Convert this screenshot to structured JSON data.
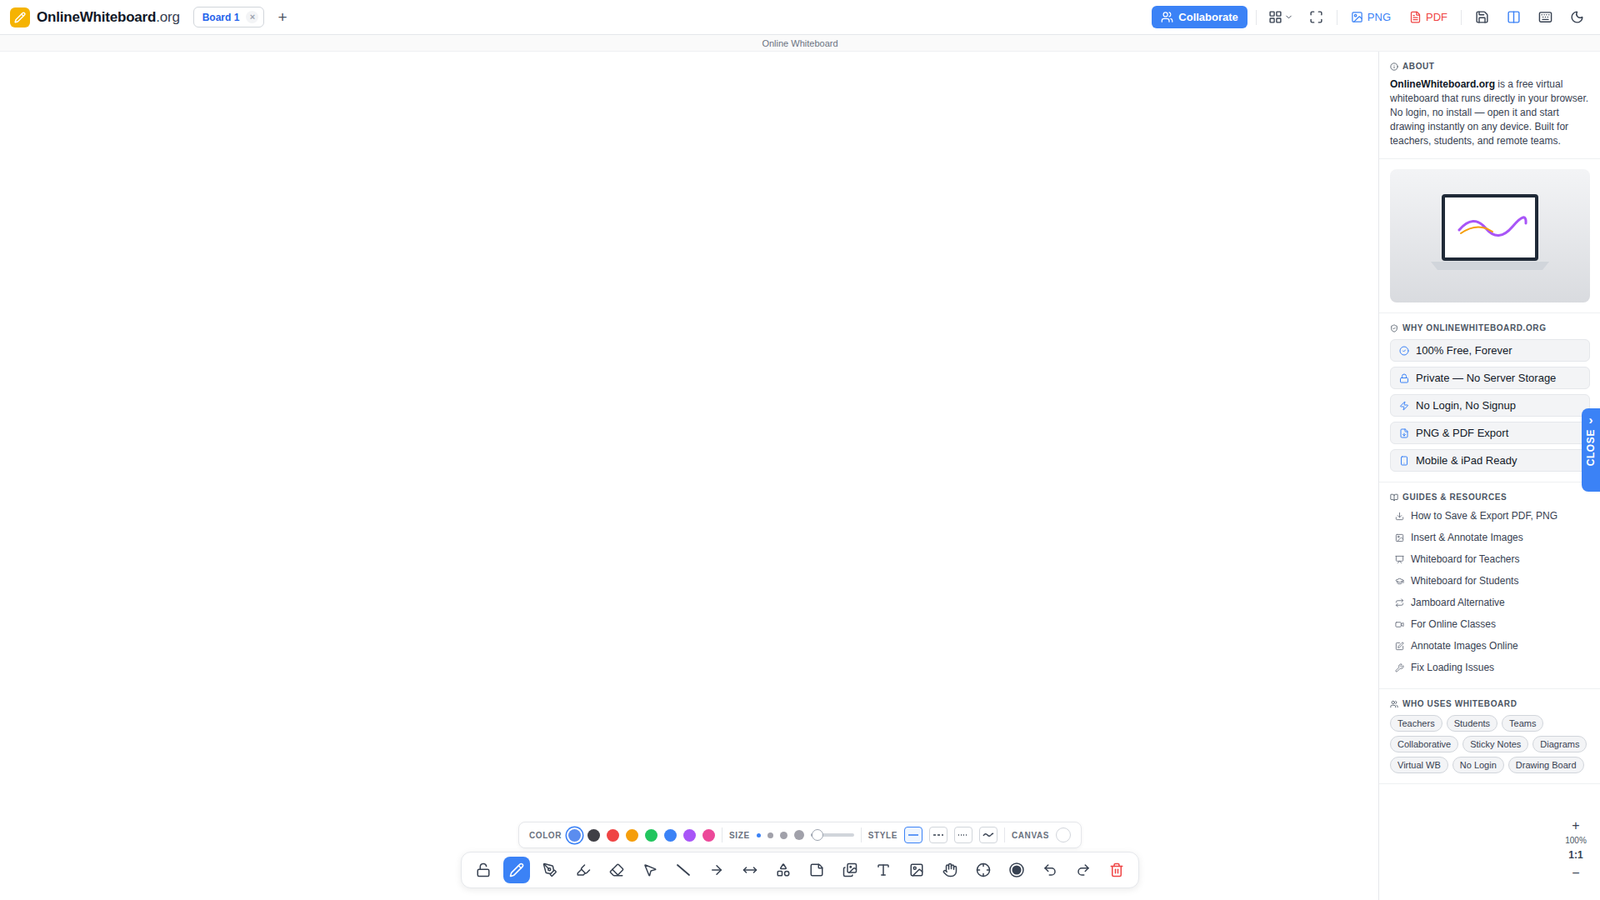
{
  "header": {
    "logo": {
      "name": "OnlineWhiteboard",
      "suffix": ".org"
    },
    "tabs": [
      {
        "label": "Board 1",
        "close": "×",
        "selected": true
      }
    ],
    "add_tab": "+",
    "collaborate": "Collaborate",
    "view_buttons": [
      {
        "selected": false
      },
      {
        "selected": false
      }
    ],
    "exports": [
      {
        "label": "PNG",
        "color": "#3b82f6"
      },
      {
        "label": "PDF",
        "color": "#ef4444"
      }
    ],
    "panel_buttons": [
      {
        "selected": false
      },
      {
        "selected": true
      },
      {
        "selected": false
      },
      {
        "selected": false
      }
    ]
  },
  "subtitle": "Online Whiteboard",
  "sidebar": {
    "about": {
      "heading": "ABOUT",
      "brand": "OnlineWhiteboard.org",
      "text": " is a free virtual whiteboard that runs directly in your browser. No login, no install — open it and start drawing instantly on any device. Built for teachers, students, and remote teams."
    },
    "why": {
      "heading": "WHY ONLINEWHITEBOARD.ORG",
      "items": [
        "100% Free, Forever",
        "Private — No Server Storage",
        "No Login, No Signup",
        "PNG & PDF Export",
        "Mobile & iPad Ready"
      ]
    },
    "guides": {
      "heading": "GUIDES & RESOURCES",
      "links": [
        "How to Save & Export PDF, PNG",
        "Insert & Annotate Images",
        "Whiteboard for Teachers",
        "Whiteboard for Students",
        "Jamboard Alternative",
        "For Online Classes",
        "Annotate Images Online",
        "Fix Loading Issues"
      ]
    },
    "who": {
      "heading": "WHO USES WHITEBOARD",
      "tags": [
        "Teachers",
        "Students",
        "Teams",
        "Collaborative",
        "Sticky Notes",
        "Diagrams",
        "Virtual WB",
        "No Login",
        "Drawing Board"
      ]
    },
    "close": {
      "label": "CLOSE",
      "chevron": "›"
    }
  },
  "zoom": {
    "zoom_in": "+",
    "level": "100%",
    "reset": "1:1",
    "zoom_out": "−"
  },
  "palette": {
    "color_label": "COLOR",
    "colors": [
      {
        "color": "#5b8def",
        "selected": true
      },
      {
        "color": "#3f3f46",
        "selected": false
      },
      {
        "color": "#ef4444",
        "selected": false
      },
      {
        "color": "#f59e0b",
        "selected": false
      },
      {
        "color": "#22c55e",
        "selected": false
      },
      {
        "color": "#3b82f6",
        "selected": false
      },
      {
        "color": "#a855f7",
        "selected": false
      },
      {
        "color": "#ec4899",
        "selected": false
      }
    ],
    "size_label": "SIZE",
    "sizes": [
      {
        "selected": true
      },
      {
        "selected": false
      },
      {
        "selected": false
      },
      {
        "selected": false
      }
    ],
    "size_level": 0.15,
    "style_label": "STYLE",
    "styles": [
      {
        "kind": "solid",
        "selected": true
      },
      {
        "kind": "dashed",
        "selected": false
      },
      {
        "kind": "dotted",
        "selected": false
      },
      {
        "kind": "wavy",
        "selected": false
      }
    ],
    "canvas_label": "CANVAS"
  },
  "tools": [
    {
      "selected": false
    },
    {
      "selected": true
    },
    {
      "selected": false
    },
    {
      "selected": false
    },
    {
      "selected": false
    },
    {
      "selected": false
    },
    {
      "selected": false
    },
    {
      "selected": false
    },
    {
      "selected": false
    },
    {
      "selected": false
    },
    {
      "selected": false
    },
    {
      "selected": false
    },
    {
      "selected": false
    },
    {
      "selected": false
    },
    {
      "selected": false
    },
    {
      "selected": false
    },
    {
      "selected": false
    },
    {
      "selected": false
    },
    {
      "selected": false
    },
    {
      "selected": false
    }
  ]
}
